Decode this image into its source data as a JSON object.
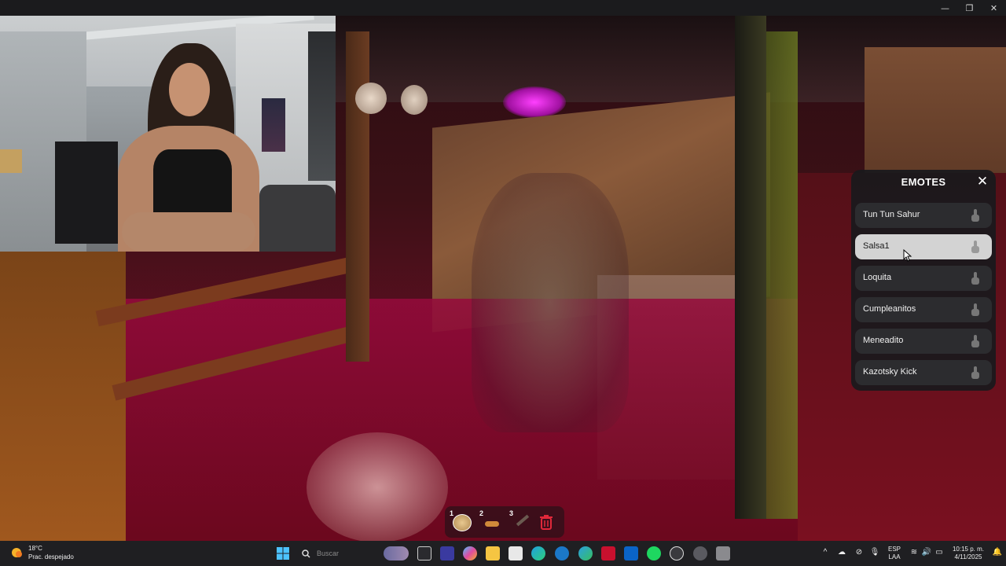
{
  "window": {
    "minimize": "—",
    "maximize": "❐",
    "close": "✕"
  },
  "emotes": {
    "title": "EMOTES",
    "close": "✕",
    "items": [
      {
        "label": "Tun Tun Sahur"
      },
      {
        "label": "Salsa1"
      },
      {
        "label": "Loquita"
      },
      {
        "label": "Cumpleanitos"
      },
      {
        "label": "Meneadito"
      },
      {
        "label": "Kazotsky Kick"
      }
    ],
    "selected_index": 1
  },
  "hotbar": {
    "slots": [
      "1",
      "2",
      "3"
    ]
  },
  "taskbar": {
    "weather_temp": "18°C",
    "weather_desc": "Prac. despejado",
    "search_placeholder": "Buscar",
    "lang_top": "ESP",
    "lang_bottom": "LAA",
    "time": "10:15 p. m.",
    "date": "4/11/2025"
  }
}
